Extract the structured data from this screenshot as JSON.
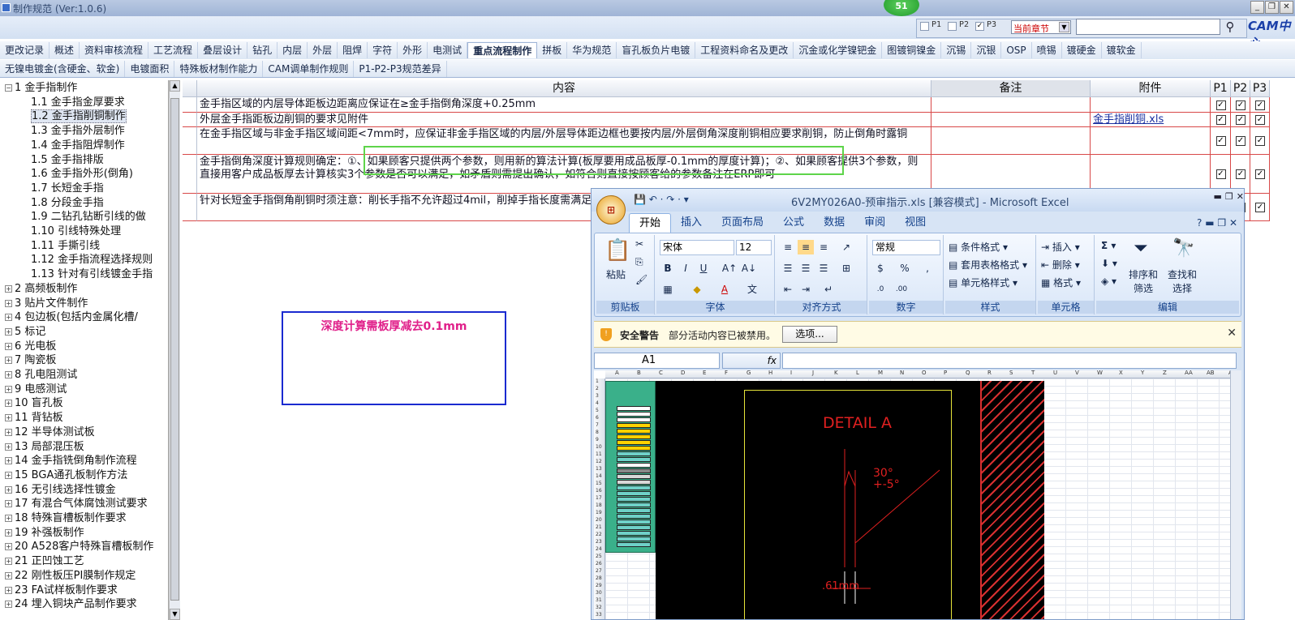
{
  "window": {
    "title": "制作规范 (Ver:1.0.6)",
    "badge": "51",
    "controls": [
      "_",
      "❐",
      "✕"
    ]
  },
  "filter": {
    "p1": {
      "label": "P1",
      "checked": false
    },
    "p2": {
      "label": "P2",
      "checked": false
    },
    "p3": {
      "label": "P3",
      "checked": true
    },
    "scope": "当前章节",
    "search_value": "",
    "brand": "CAM中心"
  },
  "tabs_row1": [
    "更改记录",
    "概述",
    "资料审核流程",
    "工艺流程",
    "叠层设计",
    "钻孔",
    "内层",
    "外层",
    "阻焊",
    "字符",
    "外形",
    "电测试",
    "重点流程制作",
    "拼板",
    "华为规范",
    "盲孔板负片电镀",
    "工程资料命名及更改",
    "沉金或化学镍钯金",
    "图镀铜镍金",
    "沉锡",
    "沉银",
    "OSP",
    "喷锡",
    "镀硬金",
    "镀软金"
  ],
  "tabs_row1_active": 12,
  "tabs_row2": [
    "无镍电镀金(含硬金、软金)",
    "电镀面积",
    "特殊板材制作能力",
    "CAM调单制作规则",
    "P1-P2-P3规范差异"
  ],
  "tree": [
    {
      "label": "1 金手指制作",
      "level": 0,
      "expander": "−"
    },
    {
      "label": "1.1 金手指金厚要求",
      "level": 1
    },
    {
      "label": "1.2 金手指削铜制作",
      "level": 1,
      "selected": true
    },
    {
      "label": "1.3 金手指外层制作",
      "level": 1
    },
    {
      "label": "1.4 金手指阻焊制作",
      "level": 1
    },
    {
      "label": "1.5 金手指排版",
      "level": 1
    },
    {
      "label": "1.6 金手指外形(倒角)",
      "level": 1
    },
    {
      "label": "1.7 长短金手指",
      "level": 1
    },
    {
      "label": "1.8 分段金手指",
      "level": 1
    },
    {
      "label": "1.9 二钻孔钻断引线的做",
      "level": 1
    },
    {
      "label": "1.10 引线特殊处理",
      "level": 1
    },
    {
      "label": "1.11 手撕引线",
      "level": 1
    },
    {
      "label": "1.12 金手指流程选择规则",
      "level": 1
    },
    {
      "label": "1.13 针对有引线镀金手指",
      "level": 1
    },
    {
      "label": "2 高频板制作",
      "level": 0,
      "expander": "+"
    },
    {
      "label": "3 贴片文件制作",
      "level": 0,
      "expander": "+"
    },
    {
      "label": "4 包边板(包括内金属化槽/",
      "level": 0,
      "expander": "+"
    },
    {
      "label": "5 标记",
      "level": 0,
      "expander": "+"
    },
    {
      "label": "6 光电板",
      "level": 0,
      "expander": "+"
    },
    {
      "label": "7 陶瓷板",
      "level": 0,
      "expander": "+"
    },
    {
      "label": "8 孔电阻测试",
      "level": 0,
      "expander": "+"
    },
    {
      "label": "9 电感测试",
      "level": 0,
      "expander": "+"
    },
    {
      "label": "10 盲孔板",
      "level": 0,
      "expander": "+"
    },
    {
      "label": "11 背钻板",
      "level": 0,
      "expander": "+"
    },
    {
      "label": "12 半导体测试板",
      "level": 0,
      "expander": "+"
    },
    {
      "label": "13 局部混压板",
      "level": 0,
      "expander": "+"
    },
    {
      "label": "14 金手指铣倒角制作流程",
      "level": 0,
      "expander": "+"
    },
    {
      "label": "15 BGA通孔板制作方法",
      "level": 0,
      "expander": "+"
    },
    {
      "label": "16 无引线选择性镀金",
      "level": 0,
      "expander": "+"
    },
    {
      "label": "17 有混合气体腐蚀测试要求",
      "level": 0,
      "expander": "+"
    },
    {
      "label": "18 特殊盲槽板制作要求",
      "level": 0,
      "expander": "+"
    },
    {
      "label": "19 补强板制作",
      "level": 0,
      "expander": "+"
    },
    {
      "label": "20 A528客户特殊盲槽板制作",
      "level": 0,
      "expander": "+"
    },
    {
      "label": "21 正凹蚀工艺",
      "level": 0,
      "expander": "+"
    },
    {
      "label": "22 刚性板压PI膜制作规定",
      "level": 0,
      "expander": "+"
    },
    {
      "label": "23 FA试样板制作要求",
      "level": 0,
      "expander": "+"
    },
    {
      "label": "24 埋入铜块产品制作要求",
      "level": 0,
      "expander": "+"
    }
  ],
  "grid": {
    "headers": {
      "content": "内容",
      "remark": "备注",
      "attachment": "附件",
      "p1": "P1",
      "p2": "P2",
      "p3": "P3"
    },
    "rows": [
      {
        "content": "金手指区域的内层导体距板边距离应保证在≥金手指倒角深度+0.25mm",
        "remark": "",
        "attachment": "",
        "p1": true,
        "p2": true,
        "p3": true
      },
      {
        "content": "外层金手指距板边削铜的要求见附件",
        "remark": "",
        "attachment": "金手指削铜.xls",
        "p1": true,
        "p2": true,
        "p3": true
      },
      {
        "content": "在金手指区域与非金手指区域间距<7mm时，应保证非金手指区域的内层/外层导体距边框也要按内层/外层倒角深度削铜相应要求削铜，防止倒角时露铜",
        "remark": "",
        "attachment": "",
        "p1": true,
        "p2": true,
        "p3": true
      },
      {
        "content": "金手指倒角深度计算规则确定：①、如果顾客只提供两个参数，则用新的算法计算(板厚要用成品板厚-0.1mm的厚度计算)；②、如果顾客提供3个参数，则直接用客户成品板厚去计算核实3个参数是否可以满足，如矛盾则需提出确认，如符合则直接按顾客给的参数备注在ERP即可",
        "remark": "",
        "attachment": "",
        "p1": true,
        "p2": true,
        "p3": true
      },
      {
        "content": "针对长短金手指倒角削铜时须注意：削长手指不允许超过4mil，削掉手指长度需满足长短手指高度差为4mil以上，否则需提出确认。",
        "remark": "",
        "attachment": "",
        "p1": true,
        "p2": true,
        "p3": true
      }
    ]
  },
  "annotation": "深度计算需板厚减去0.1mm",
  "excel": {
    "title": "6V2MY026A0-预审指示.xls  [兼容模式] - Microsoft Excel",
    "orb": "⊞",
    "tabs": [
      "开始",
      "插入",
      "页面布局",
      "公式",
      "数据",
      "审阅",
      "视图"
    ],
    "active_tab": 0,
    "groups": {
      "clipboard": {
        "name": "剪贴板",
        "paste": "粘贴"
      },
      "font": {
        "name": "字体",
        "family": "宋体",
        "size": "12"
      },
      "alignment": {
        "name": "对齐方式"
      },
      "number": {
        "name": "数字",
        "format": "常规"
      },
      "styles": {
        "name": "样式",
        "cond": "条件格式",
        "table": "套用表格格式",
        "cell": "单元格样式"
      },
      "cells": {
        "name": "单元格",
        "insert": "插入",
        "delete": "删除",
        "format": "格式"
      },
      "editing": {
        "name": "编辑",
        "sort": "排序和筛选",
        "find": "查找和选择"
      }
    },
    "security": {
      "title": "安全警告",
      "message": "部分活动内容已被禁用。",
      "options": "选项..."
    },
    "namebox": "A1",
    "fx": "fx",
    "cam": {
      "detail": "DETAIL A",
      "angle1": "30°",
      "angle2": "+-5°",
      "dim": ".61mm"
    }
  }
}
